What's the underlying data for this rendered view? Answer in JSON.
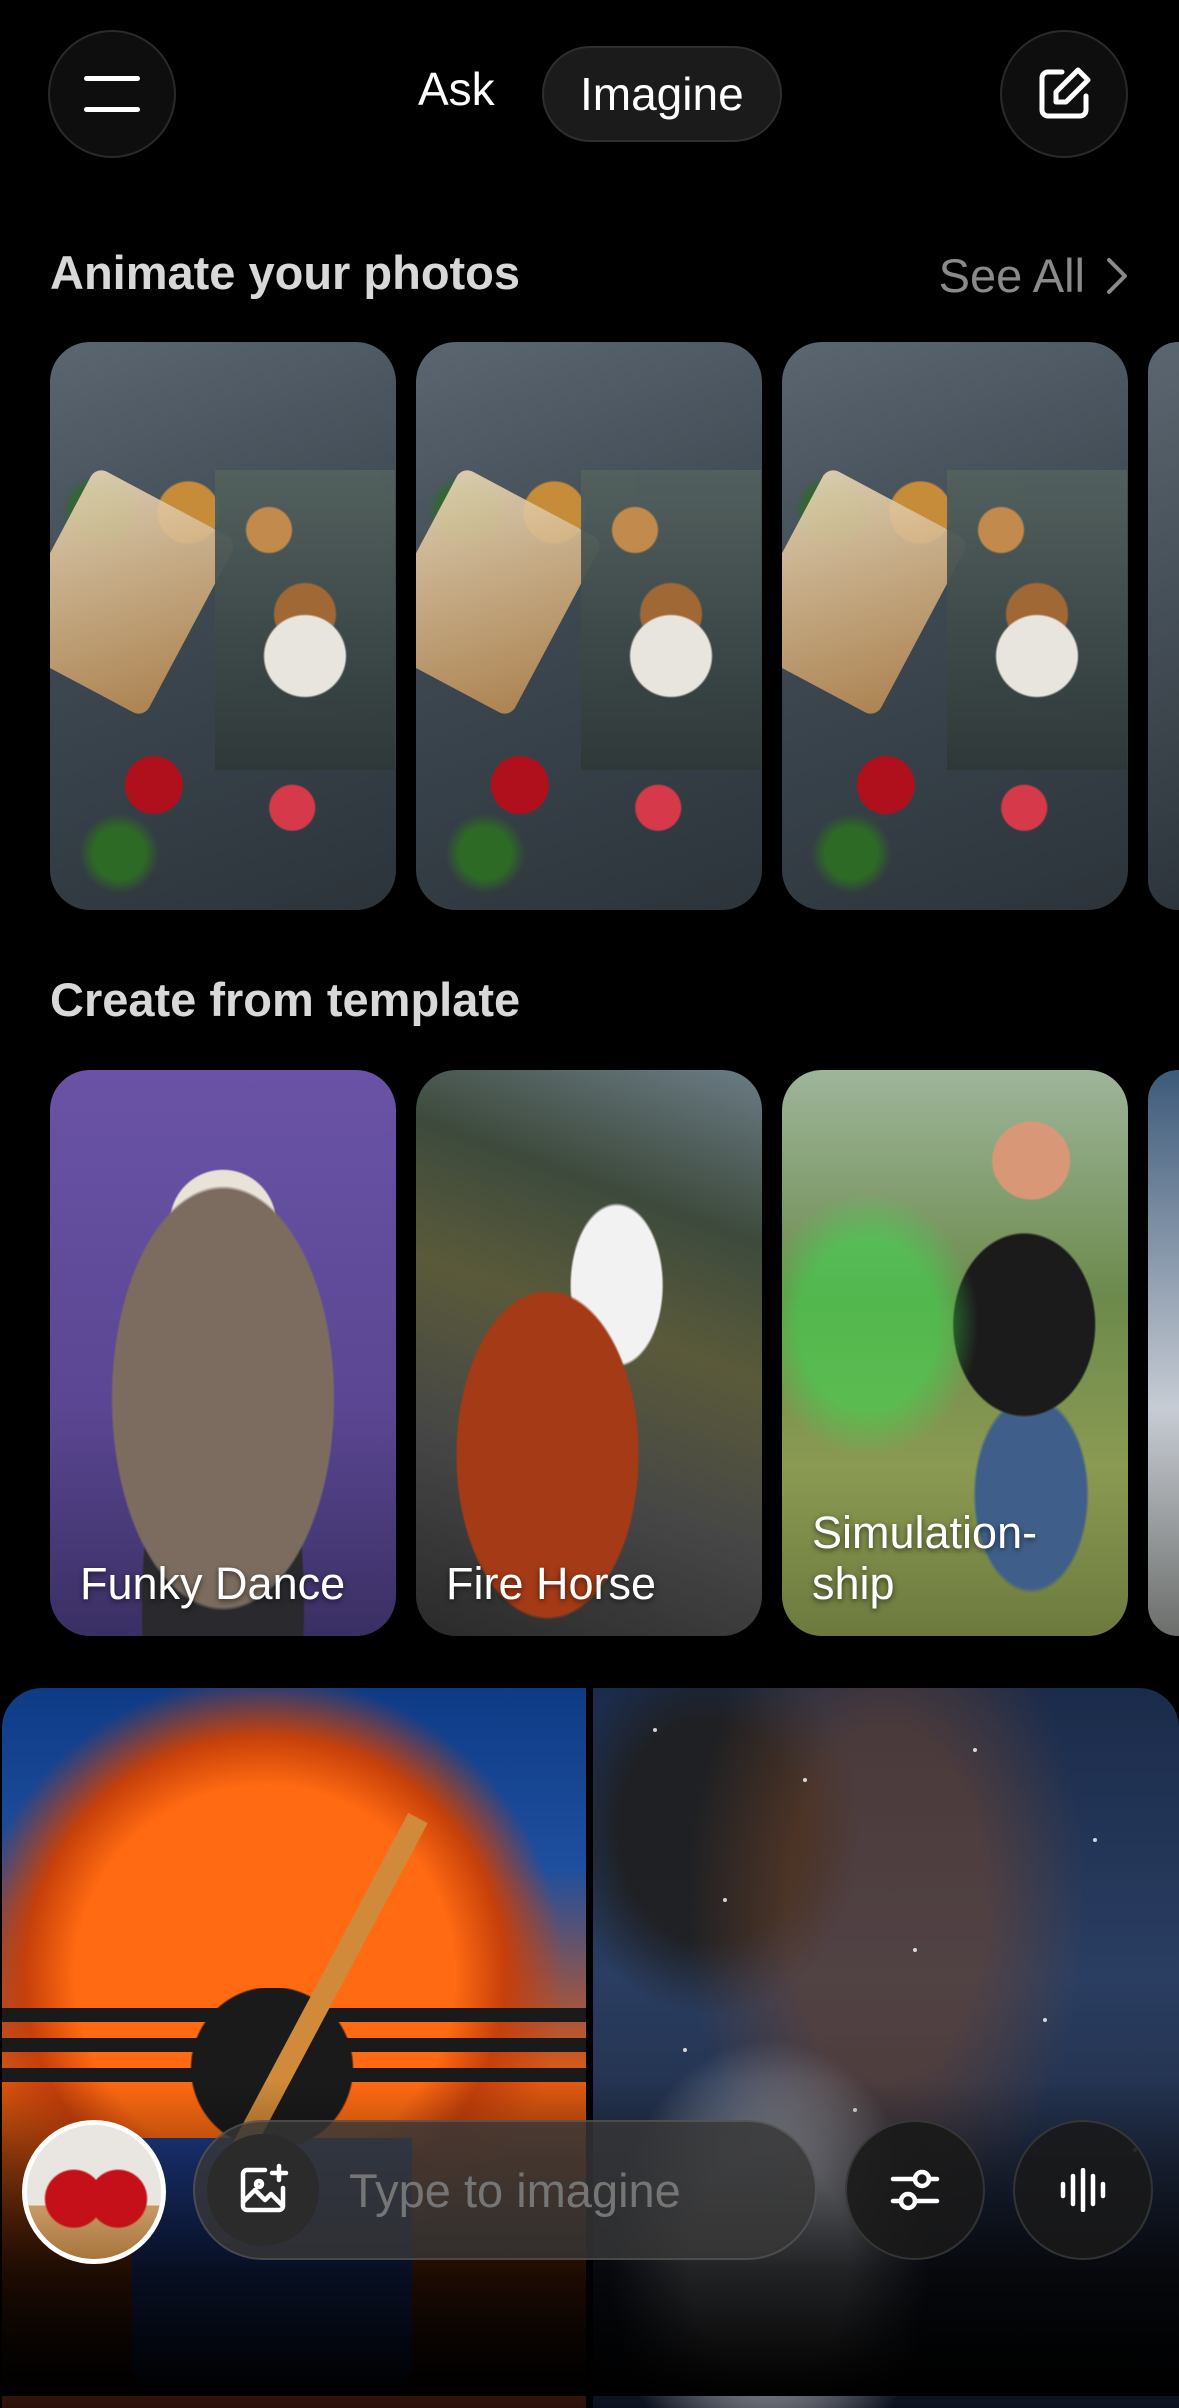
{
  "header": {
    "tabs": [
      {
        "label": "Ask",
        "active": false
      },
      {
        "label": "Imagine",
        "active": true
      }
    ],
    "menu_icon": "hamburger-menu-icon",
    "new_icon": "edit-compose-icon"
  },
  "sections": {
    "animate": {
      "title": "Animate your photos",
      "see_all": "See All"
    },
    "templates": {
      "title": "Create from template",
      "items": [
        {
          "label": "Funky Dance"
        },
        {
          "label": "Fire Horse"
        },
        {
          "label": "Simulation-ship"
        }
      ]
    }
  },
  "dock": {
    "placeholder": "Type to imagine",
    "image_add_icon": "image-add-icon",
    "settings_icon": "sliders-icon",
    "voice_icon": "voice-waveform-icon"
  },
  "colors": {
    "background": "#000000",
    "text_primary": "#ffffff",
    "text_secondary": "#8a8a8a"
  }
}
